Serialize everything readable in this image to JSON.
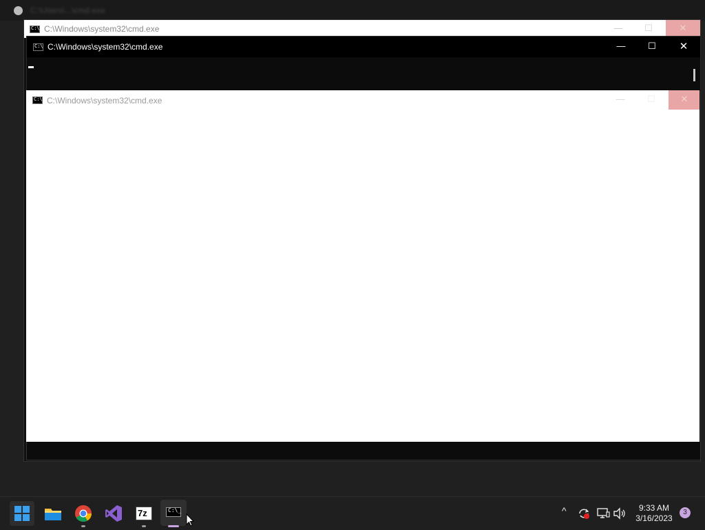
{
  "background_app": {
    "title": "C:\\Users\\...\\cmd.exe"
  },
  "windows": {
    "back": {
      "title": "C:\\Windows\\system32\\cmd.exe"
    },
    "middle": {
      "title": "C:\\Windows\\system32\\cmd.exe"
    },
    "front": {
      "title": "C:\\Windows\\system32\\cmd.exe"
    }
  },
  "window_controls": {
    "minimize": "—",
    "maximize": "☐",
    "close": "✕"
  },
  "taskbar": {
    "apps": [
      {
        "name": "Start",
        "icon": "windows-logo-icon"
      },
      {
        "name": "File Explorer",
        "icon": "folder-icon"
      },
      {
        "name": "Google Chrome",
        "icon": "chrome-icon"
      },
      {
        "name": "Visual Studio",
        "icon": "visual-studio-icon"
      },
      {
        "name": "7-Zip",
        "icon": "7zip-icon",
        "label": "7z"
      },
      {
        "name": "Command Prompt",
        "icon": "cmd-icon",
        "label": "C:\\_"
      }
    ],
    "tray": {
      "chevron": "^",
      "time": "9:33 AM",
      "date": "3/16/2023",
      "notifications": "3"
    }
  },
  "colors": {
    "accent_blue": "#3aa0f0",
    "close_hover": "#e9a6a6",
    "active_indicator": "#c9a5e0"
  }
}
